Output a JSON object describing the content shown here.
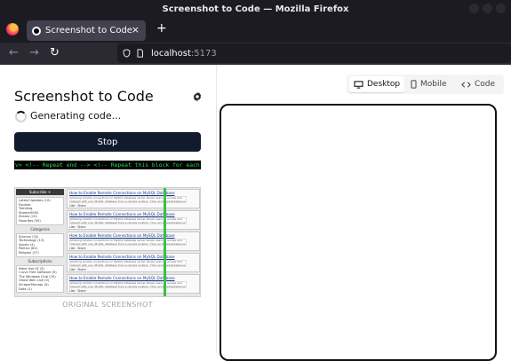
{
  "window": {
    "title": "Screenshot to Code — Mozilla Firefox"
  },
  "tabs": [
    {
      "label": "Screenshot to Code",
      "close": "×"
    }
  ],
  "new_tab": "+",
  "nav": {
    "back": "←",
    "forward": "→",
    "reload": "↻",
    "url_host": "localhost",
    "url_port": ":5173"
  },
  "app": {
    "title": "Screenshot to Code",
    "status": "Generating code...",
    "stop_label": "Stop",
    "code_stream": "v> <!-- Repeat end --> <!-- Repeat this block for each",
    "code_stream_tail": " each",
    "original_label": "ORIGINAL SCREENSHOT"
  },
  "thumbnail": {
    "sidebar_header": "Subscribe +",
    "sidebar_box1": [
      "Latest Updates (10)",
      "Explore",
      "Trending",
      "Stream0000",
      "Shares (10)",
      "Favorites (50)"
    ],
    "categories_label": "Categories",
    "sidebar_box2": [
      "Science (32)",
      "Technology (13)",
      "Sports (4)",
      "Politics (62)",
      "Religion (27)"
    ],
    "subscriptions_label": "Subscriptions",
    "sidebar_box3": [
      "Make Use Of (3)",
      "I Love Free Software (0)",
      "The Windows Club (70)",
      "Ghost Wen Live (0)",
      "ScraperMonagr (0)",
      "Data (1)"
    ],
    "card_title": "How to Enable Remote Connections on MySQL Database",
    "card_body": "Allowing remote connections on MySQL database server allows users to access and interact with your MySQL database from a remote location. This can be advantageous in a number of scenarios.",
    "card_foot": "Like · Share",
    "card_count": 5
  },
  "view_tabs": [
    {
      "label": "Desktop",
      "icon": "desktop-icon",
      "active": true
    },
    {
      "label": "Mobile",
      "icon": "mobile-icon",
      "active": false
    },
    {
      "label": "Code",
      "icon": "code-icon",
      "active": false
    }
  ],
  "colors": {
    "chrome_dark": "#1c1b22",
    "stop_button": "#121a2e",
    "code_green": "#2bd94f"
  }
}
